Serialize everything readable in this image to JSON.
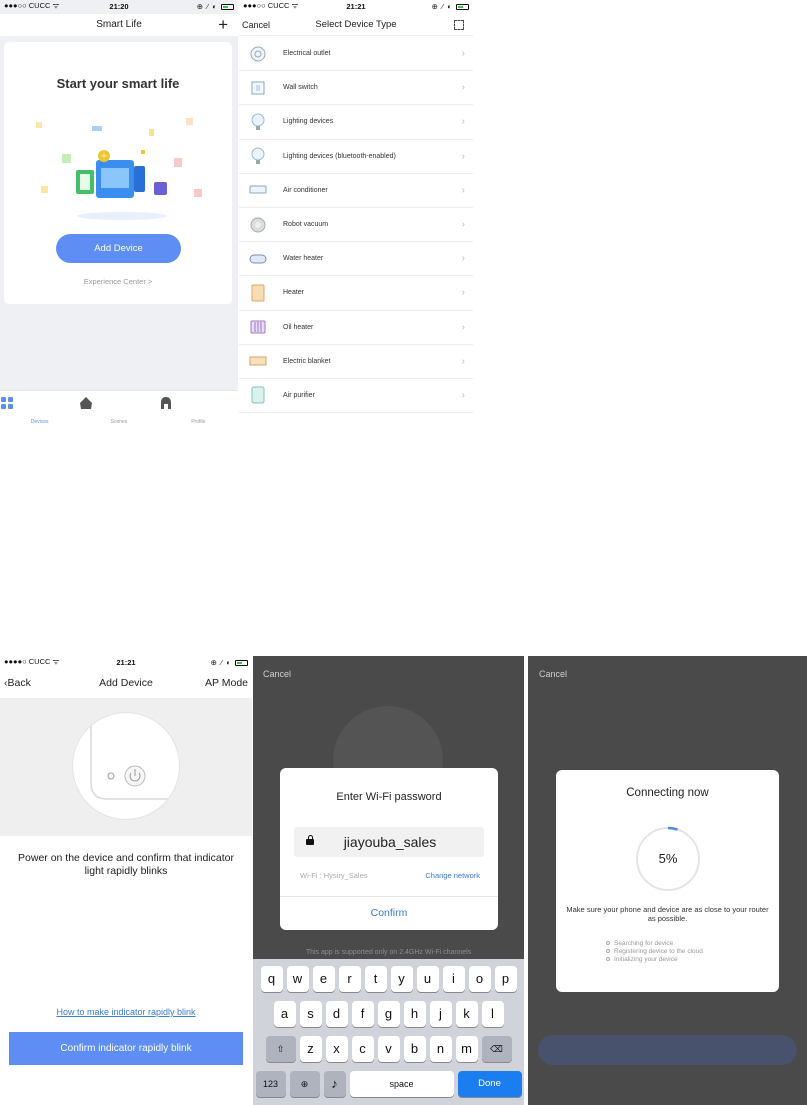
{
  "status_bars": {
    "s1": {
      "carrier": "●●●○○ CUCC ᯤ",
      "time": "21:20",
      "icons": "⊕ ⁄ ◐"
    },
    "s2": {
      "carrier": "●●●○○ CUCC ᯤ",
      "time": "21:21",
      "icons": "⊕ ⁄ ◐"
    },
    "s3": {
      "carrier": "●●●●○ CUCC ᯤ",
      "time": "21:21",
      "icons": "⊕ ⁄ ◐"
    }
  },
  "smart_life": {
    "title": "Smart Life",
    "add_icon": "plus-icon",
    "headline": "Start your smart life",
    "add_device_label": "Add Device",
    "experience_link": "Experience Center >",
    "accent": "#5e8ef3",
    "tabs": [
      {
        "label": "Devices",
        "icon": "devices-grid-icon",
        "active": true
      },
      {
        "label": "Scenes",
        "icon": "home-icon",
        "active": false
      },
      {
        "label": "Profile",
        "icon": "profile-icon",
        "active": false
      }
    ]
  },
  "select_type": {
    "cancel_label": "Cancel",
    "title": "Select Device Type",
    "scan_icon": "scan-icon",
    "items": [
      {
        "label": "Electrical outlet",
        "icon": "outlet-icon"
      },
      {
        "label": "Wall switch",
        "icon": "wall-switch-icon"
      },
      {
        "label": "Lighting devices",
        "icon": "bulb-icon"
      },
      {
        "label": "Lighting devices (bluetooth-enabled)",
        "icon": "bulb-icon"
      },
      {
        "label": "Air conditioner",
        "icon": "air-conditioner-icon"
      },
      {
        "label": "Robot vacuum",
        "icon": "robot-vacuum-icon"
      },
      {
        "label": "Water heater",
        "icon": "water-heater-icon"
      },
      {
        "label": "Heater",
        "icon": "heater-icon"
      },
      {
        "label": "Oil heater",
        "icon": "oil-heater-icon"
      },
      {
        "label": "Electric blanket",
        "icon": "blanket-icon"
      },
      {
        "label": "Air purifier",
        "icon": "air-purifier-icon"
      }
    ]
  },
  "add_device": {
    "back_label": "Back",
    "title": "Add Device",
    "ap_mode_label": "AP Mode",
    "instruction": "Power on the device and confirm that indicator light rapidly blinks",
    "help_link": "How to make indicator rapidly blink",
    "confirm_label": "Confirm indicator rapidly blink"
  },
  "wifi_password": {
    "cancel_label": "Cancel",
    "dialog_title": "Enter Wi-Fi password",
    "password_value": "jiayouba_sales",
    "wifi_label": "Wi-Fi : Hysiry_Sales",
    "change_network_label": "Change network",
    "confirm_label": "Confirm",
    "note": "This app is supported only on 2.4GHz Wi-Fi channels",
    "keyboard": {
      "row1": [
        "q",
        "w",
        "e",
        "r",
        "t",
        "y",
        "u",
        "i",
        "o",
        "p"
      ],
      "row2": [
        "a",
        "s",
        "d",
        "f",
        "g",
        "h",
        "j",
        "k",
        "l"
      ],
      "row3": [
        "z",
        "x",
        "c",
        "v",
        "b",
        "n",
        "m"
      ],
      "num_label": "123",
      "space_label": "space",
      "done_label": "Done"
    }
  },
  "connecting": {
    "cancel_label": "Cancel",
    "dialog_title": "Connecting now",
    "progress_percent": 5,
    "progress_label": "5%",
    "tip": "Make sure your phone and device are as close to your router as possible.",
    "steps": [
      "Searching for device",
      "Registering device to the cloud",
      "Initializing your device"
    ]
  }
}
